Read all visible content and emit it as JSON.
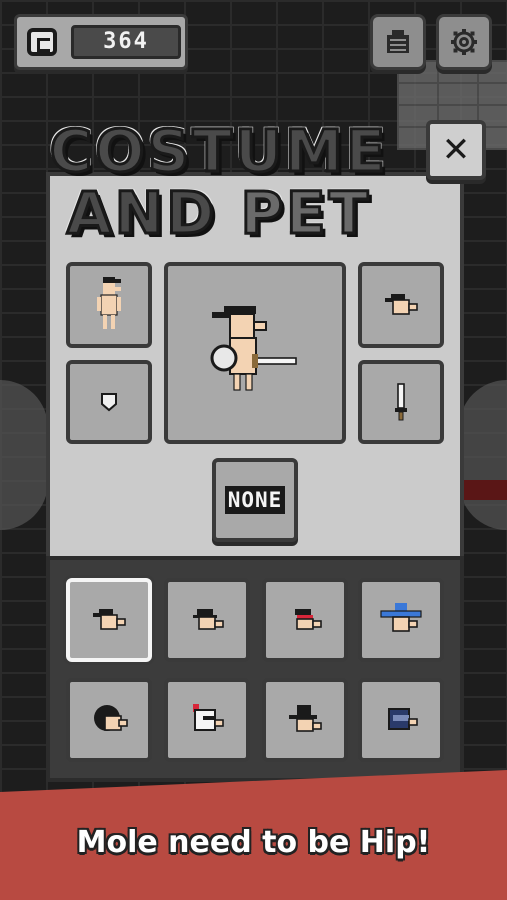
{
  "currency": {
    "icon": "coin-icon",
    "amount": "364"
  },
  "hud": {
    "shop_icon": "shop-icon",
    "settings_icon": "gear-icon"
  },
  "title": {
    "line1": "COSTUME",
    "line2_part1": "AND",
    "line2_part2": "PET"
  },
  "close_icon": "close-icon",
  "equipped": {
    "body_icon": "mole-body-icon",
    "hat_icon": "hat-icon",
    "shield_icon": "shield-icon",
    "weapon_icon": "sword-icon",
    "preview_icon": "mole-character-preview"
  },
  "none_button": {
    "label": "NONE"
  },
  "hat_grid": [
    {
      "icon": "black-hat-icon",
      "selected": true
    },
    {
      "icon": "black-bowler-hat-icon",
      "selected": false
    },
    {
      "icon": "red-band-hat-icon",
      "selected": false
    },
    {
      "icon": "blue-wizard-hat-icon",
      "selected": false
    },
    {
      "icon": "afro-hair-icon",
      "selected": false
    },
    {
      "icon": "knight-helmet-icon",
      "selected": false
    },
    {
      "icon": "top-hat-icon",
      "selected": false
    },
    {
      "icon": "navy-helmet-icon",
      "selected": false
    }
  ],
  "banner": {
    "text": "Mole need to be Hip!"
  },
  "colors": {
    "banner": "#b84a41",
    "panel": "#cbcbcb",
    "slot": "#a9a9a9"
  }
}
